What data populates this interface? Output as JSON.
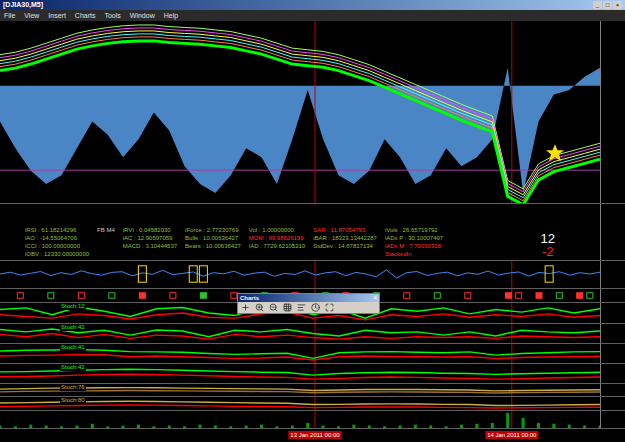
{
  "window": {
    "title": "[DJIA30,M5]",
    "buttons": [
      "_",
      "□",
      "×"
    ]
  },
  "menu": [
    "File",
    "View",
    "Insert",
    "Charts",
    "Tools",
    "Window",
    "Help"
  ],
  "chart": {
    "day_separators": [
      0.525,
      0.853
    ],
    "price": [
      11812,
      11815,
      11820,
      11826,
      11832,
      11838,
      11842,
      11845,
      11847,
      11848,
      11848,
      11846,
      11845,
      11844,
      11842,
      11840,
      11836,
      11832,
      11826,
      11820,
      11818,
      11816,
      11812,
      11806,
      11800,
      11792,
      11784,
      11776,
      11768,
      11760,
      11752,
      11745,
      11738,
      11660,
      11650,
      11680,
      11690,
      11695,
      11700,
      11705
    ],
    "histogram": [
      40,
      70,
      95,
      110,
      100,
      70,
      40,
      55,
      80,
      60,
      30,
      50,
      90,
      110,
      120,
      100,
      70,
      80,
      110,
      60,
      5,
      60,
      100,
      110,
      95,
      60,
      80,
      110,
      100,
      70,
      90,
      80,
      60,
      -20,
      120,
      40,
      10,
      5,
      -10,
      -20
    ],
    "indicators": [
      [
        {
          "text": "iRSI : 61.18214296",
          "color": "#8fbf3f"
        },
        {
          "text": "iAO : -14.55064706",
          "color": "#8fbf3f"
        },
        {
          "text": "iCCI : 100.00000000",
          "color": "#8fbf3f"
        },
        {
          "text": "iOBV : 12330.00000000",
          "color": "#8fbf3f"
        }
      ],
      [
        {
          "text": "FB M4",
          "color": "#c8c8c8"
        }
      ],
      [
        {
          "text": "iRVI : 0.04582030",
          "color": "#8fbf3f"
        },
        {
          "text": "iAC : 12.90597059",
          "color": "#8fbf3f"
        },
        {
          "text": "MACD : 3.10444537",
          "color": "#8fbf3f"
        }
      ],
      [
        {
          "text": "iForce : 2.77230769",
          "color": "#8fbf3f"
        },
        {
          "text": "Bulls : 10.00636427",
          "color": "#8fbf3f"
        },
        {
          "text": "Bears : 10.00636427",
          "color": "#8fbf3f"
        }
      ],
      [
        {
          "text": "Vol : 1.00000000",
          "color": "#8fbf3f"
        },
        {
          "text": "MOM : 99.98626199",
          "color": "#ff3030"
        },
        {
          "text": "iAD : 7729.62105210",
          "color": "#8fbf3f"
        }
      ],
      [
        {
          "text": "SAR : 11.87054793",
          "color": "#ff3030"
        },
        {
          "text": "iBAR : 18323.13442287",
          "color": "#8fbf3f"
        },
        {
          "text": "StdDev : 14.67817134",
          "color": "#8fbf3f"
        }
      ],
      [
        {
          "text": "iVols : 26.65719792",
          "color": "#8fbf3f"
        },
        {
          "text": "iADx P : 30.10007497",
          "color": "#8fbf3f"
        },
        {
          "text": "iADx M : 7.70030338",
          "color": "#ff3030"
        },
        {
          "text": "StackedIn",
          "color": "#ff3030"
        }
      ]
    ],
    "signal": {
      "top": "12",
      "top_color": "#ffffff",
      "bottom": "-2",
      "bottom_color": "#ff2020"
    },
    "oscillator": {
      "values": [
        52,
        60,
        48,
        55,
        63,
        45,
        58,
        50,
        66,
        54,
        47,
        59,
        62,
        44,
        57,
        51,
        68,
        49,
        55,
        61,
        43,
        58,
        53,
        64,
        47,
        56,
        60,
        42,
        55,
        50,
        66,
        48,
        57,
        62,
        45,
        59,
        52,
        40,
        70,
        35,
        58,
        63,
        46,
        55,
        60,
        44,
        57,
        51,
        65,
        48,
        56,
        61,
        43,
        59,
        54,
        62,
        47,
        58,
        52,
        60
      ],
      "markers": [
        14,
        19,
        20,
        54
      ]
    },
    "squares": [
      {
        "index": 2,
        "color": "#ff3030",
        "filled": false
      },
      {
        "index": 5,
        "color": "#30c030",
        "filled": false
      },
      {
        "index": 8,
        "color": "#ff3030",
        "filled": false
      },
      {
        "index": 11,
        "color": "#30c030",
        "filled": false
      },
      {
        "index": 14,
        "color": "#ff3030",
        "filled": true
      },
      {
        "index": 17,
        "color": "#ff3030",
        "filled": false
      },
      {
        "index": 20,
        "color": "#30c030",
        "filled": true
      },
      {
        "index": 23,
        "color": "#ff3030",
        "filled": false
      },
      {
        "index": 26,
        "color": "#30c030",
        "filled": false
      },
      {
        "index": 29,
        "color": "#ff3030",
        "filled": false
      },
      {
        "index": 32,
        "color": "#30c030",
        "filled": false
      },
      {
        "index": 34,
        "color": "#ff3030",
        "filled": false
      },
      {
        "index": 37,
        "color": "#30c030",
        "filled": false
      },
      {
        "index": 40,
        "color": "#ff3030",
        "filled": false
      },
      {
        "index": 43,
        "color": "#30c030",
        "filled": false
      },
      {
        "index": 46,
        "color": "#ff3030",
        "filled": false
      },
      {
        "index": 50,
        "color": "#ff3030",
        "filled": true
      },
      {
        "index": 51,
        "color": "#ff3030",
        "filled": false
      },
      {
        "index": 53,
        "color": "#ff3030",
        "filled": true
      },
      {
        "index": 55,
        "color": "#30c030",
        "filled": false
      },
      {
        "index": 57,
        "color": "#ff3030",
        "filled": true
      },
      {
        "index": 58,
        "color": "#30c030",
        "filled": false
      }
    ],
    "stochastics": [
      {
        "label": "Stoch:12",
        "lines": [
          {
            "color": "#00ff00",
            "values": [
              70,
              80,
              40,
              85,
              60,
              30,
              75,
              82,
              50,
              35,
              78,
              84,
              40,
              70,
              20,
              75,
              60,
              80,
              45,
              70,
              55,
              80,
              50,
              75
            ]
          },
          {
            "color": "#ff0000",
            "values": [
              40,
              30,
              20,
              45,
              35,
              15,
              40,
              50,
              25,
              20,
              45,
              55,
              20,
              35,
              10,
              40,
              30,
              45,
              25,
              40,
              30,
              45,
              25,
              35
            ]
          }
        ]
      },
      {
        "label": "Stoch:42",
        "lines": [
          {
            "color": "#00ff00",
            "values": [
              75,
              60,
              78,
              55,
              70,
              40,
              72,
              65,
              30,
              70,
              60,
              75,
              50,
              35,
              70,
              55,
              60,
              40,
              60,
              35,
              70,
              60,
              55,
              65
            ]
          },
          {
            "color": "#ff0000",
            "values": [
              45,
              30,
              50,
              25,
              45,
              20,
              40,
              35,
              15,
              45,
              30,
              40,
              25,
              15,
              30,
              20,
              30,
              25,
              30,
              20,
              35,
              30,
              25,
              30
            ]
          }
        ]
      },
      {
        "label": "Stoch:41",
        "lines": [
          {
            "color": "#00ff00",
            "values": [
              65,
              70,
              72,
              74,
              70,
              62,
              60,
              58,
              50,
              45,
              48,
              52,
              20,
              55,
              60,
              62,
              58,
              55,
              60,
              40,
              50,
              55,
              60,
              62
            ]
          },
          {
            "color": "#ff0000",
            "values": [
              35,
              38,
              40,
              45,
              42,
              30,
              35,
              30,
              25,
              20,
              22,
              28,
              10,
              30,
              35,
              32,
              30,
              28,
              30,
              20,
              25,
              28,
              30,
              32
            ]
          }
        ]
      },
      {
        "label": "Stoch:42",
        "lines": [
          {
            "color": "#00ff00",
            "values": [
              60,
              62,
              65,
              70,
              74,
              76,
              74,
              70,
              66,
              62,
              58,
              56,
              40,
              50,
              55,
              58,
              56,
              52,
              50,
              45,
              48,
              52,
              55,
              58
            ]
          },
          {
            "color": "#ff0000",
            "values": [
              30,
              32,
              35,
              40,
              44,
              46,
              44,
              40,
              36,
              32,
              28,
              26,
              15,
              20,
              25,
              28,
              26,
              22,
              20,
              15,
              18,
              22,
              25,
              28
            ]
          }
        ]
      },
      {
        "label": "Stoch:76",
        "lines": [
          {
            "color": "#c8b040",
            "values": [
              60,
              65,
              70,
              72,
              75,
              76,
              74,
              70,
              68,
              65,
              62,
              60,
              45,
              50,
              55,
              56,
              55,
              52,
              50,
              40,
              45,
              48,
              50,
              52
            ]
          },
          {
            "color": "#a07030",
            "values": [
              30,
              35,
              38,
              40,
              42,
              44,
              42,
              40,
              38,
              36,
              34,
              32,
              20,
              25,
              28,
              30,
              28,
              26,
              24,
              18,
              22,
              24,
              26,
              28
            ]
          }
        ]
      },
      {
        "label": "Stoch:80",
        "lines": [
          {
            "color": "#c8b040",
            "values": [
              55,
              58,
              62,
              66,
              70,
              72,
              70,
              66,
              62,
              58,
              55,
              52,
              40,
              42,
              45,
              46,
              45,
              42,
              40,
              30,
              32,
              35,
              38,
              40
            ]
          },
          {
            "color": "#ff0000",
            "values": [
              20,
              22,
              26,
              30,
              34,
              36,
              34,
              30,
              26,
              22,
              20,
              18,
              10,
              12,
              15,
              16,
              15,
              12,
              10,
              5,
              8,
              10,
              12,
              14
            ]
          }
        ]
      }
    ],
    "volume": [
      3,
      2,
      4,
      3,
      2,
      3,
      5,
      2,
      3,
      4,
      2,
      3,
      2,
      4,
      3,
      2,
      3,
      4,
      2,
      3,
      6,
      3,
      2,
      4,
      3,
      2,
      3,
      4,
      3,
      2,
      4,
      5,
      6,
      18,
      12,
      6,
      5,
      4,
      3,
      3
    ],
    "time_labels": [
      {
        "text": "13 Jan 2011 00:00",
        "at": 0.525
      },
      {
        "text": "14 Jan 2011 00:00",
        "at": 0.853
      }
    ]
  },
  "toolbar": {
    "title": "Charts",
    "close": "×"
  }
}
